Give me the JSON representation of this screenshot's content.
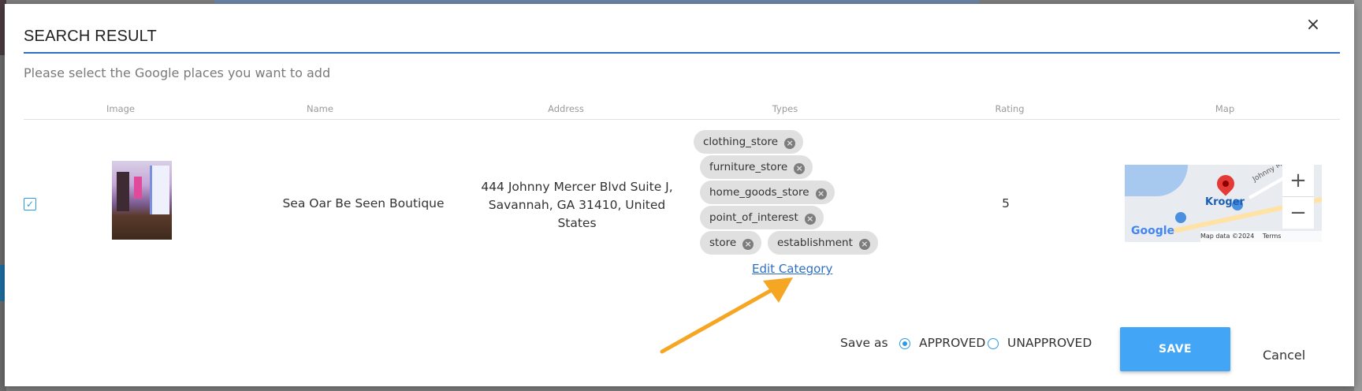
{
  "modal": {
    "title": "SEARCH RESULT",
    "close_symbol": "×",
    "subtitle": "Please select the Google places you want to add"
  },
  "table": {
    "columns": [
      "Image",
      "Name",
      "Address",
      "Types",
      "Rating",
      "Map"
    ],
    "rows": [
      {
        "selected": true,
        "name": "Sea Oar Be Seen Boutique",
        "address": "444 Johnny Mercer Blvd Suite J, Savannah, GA 31410, United States",
        "types": [
          "clothing_store",
          "furniture_store",
          "home_goods_store",
          "point_of_interest",
          "store",
          "establishment"
        ],
        "rating": "5",
        "edit_category_label": "Edit Category",
        "map": {
          "place_label": "Kroger",
          "street_label": "Johnny Mer",
          "logo": "Google",
          "footer": [
            "Map data ©2024",
            "Terms"
          ]
        }
      }
    ]
  },
  "icons": {
    "checkbox": "checked-checkbox-icon",
    "chip_remove": "remove-chip-icon",
    "zoom_in": "+",
    "zoom_out": "−",
    "annotation": "arrow-icon"
  },
  "footer": {
    "save_as_label": "Save as",
    "options": [
      "APPROVED",
      "UNAPPROVED"
    ],
    "selected_option": "APPROVED",
    "save_label": "SAVE",
    "cancel_label": "Cancel"
  },
  "colors": {
    "accent": "#2f6fc3",
    "save_button": "#42a5f5",
    "chip_bg": "#e0e0e0",
    "annotation_arrow": "#f5a623"
  }
}
